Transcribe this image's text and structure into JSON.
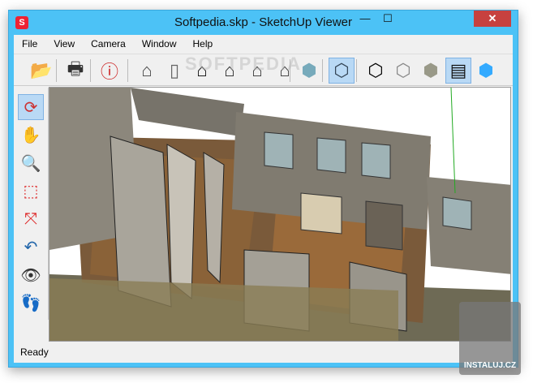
{
  "window": {
    "title": "Softpedia.skp - SketchUp Viewer",
    "minimize": "—",
    "maximize": "☐",
    "close": "✕"
  },
  "menu": [
    "File",
    "View",
    "Camera",
    "Window",
    "Help"
  ],
  "toolbar": {
    "icons": [
      "open-icon",
      "print-icon",
      "model-info-icon",
      "iso-view-icon",
      "top-view-icon",
      "front-view-icon",
      "right-view-icon",
      "back-view-icon",
      "left-view-icon",
      "xray-icon",
      "back-edges-icon",
      "wireframe-icon",
      "hidden-line-icon",
      "shaded-icon",
      "shaded-textures-icon",
      "monochrome-icon"
    ],
    "active": [
      "back-edges-icon",
      "shaded-textures-icon"
    ]
  },
  "left_tools": {
    "icons": [
      "orbit-icon",
      "pan-icon",
      "zoom-icon",
      "zoom-window-icon",
      "zoom-extents-icon",
      "previous-view-icon",
      "look-around-icon",
      "walk-icon"
    ],
    "active": "orbit-icon"
  },
  "status": "Ready",
  "watermark": "INSTALUJ.CZ",
  "softpedia_watermark": "SOFTPEDIA"
}
